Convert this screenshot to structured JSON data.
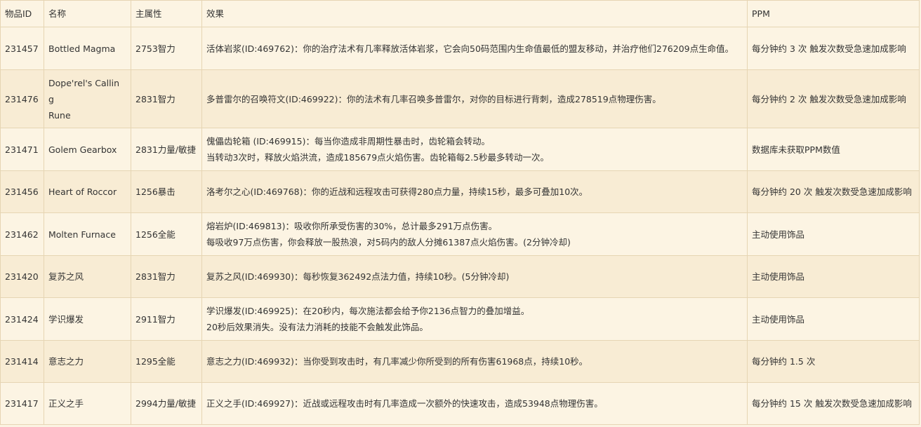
{
  "columns": {
    "id": "物品ID",
    "name": "名称",
    "stat": "主属性",
    "effect": "效果",
    "ppm": "PPM"
  },
  "rows": [
    {
      "id": "231457",
      "name": "Bottled Magma",
      "stat": "2753智力",
      "effect": [
        "活体岩浆(ID:469762)：你的治疗法术有几率释放活体岩浆，它会向50码范围内生命值最低的盟友移动，并治疗他们276209点生命值。"
      ],
      "ppm": "每分钟约 3 次 触发次数受急速加成影响"
    },
    {
      "id": "231476",
      "name": "Dope'rel's Callin g\n Rune",
      "stat": "2831智力",
      "effect": [
        "多普雷尔的召唤符文(ID:469922)：你的法术有几率召唤多普雷尔，对你的目标进行背刺，造成278519点物理伤害。"
      ],
      "ppm": "每分钟约 2 次 触发次数受急速加成影响"
    },
    {
      "id": "231471",
      "name": "Golem Gearbox",
      "stat": "2831力量/敏捷",
      "effect": [
        "傀儡齿轮箱 (ID:469915)：每当你造成非周期性暴击时，齿轮箱会转动。",
        "当转动3次时，释放火焰洪流，造成185679点火焰伤害。齿轮箱每2.5秒最多转动一次。"
      ],
      "ppm": "数据库未获取PPM数值"
    },
    {
      "id": "231456",
      "name": "Heart of Roccor",
      "stat": "1256暴击",
      "effect": [
        "洛考尔之心(ID:469768)：你的近战和远程攻击可获得280点力量，持续15秒，最多可叠加10次。"
      ],
      "ppm": "每分钟约 20 次 触发次数受急速加成影响"
    },
    {
      "id": "231462",
      "name": "Molten Furnace",
      "stat": "1256全能",
      "effect": [
        "熔岩炉(ID:469813)：吸收你所承受伤害的30%，总计最多291万点伤害。",
        "每吸收97万点伤害，你会释放一股热浪，对5码内的敌人分摊61387点火焰伤害。(2分钟冷却)"
      ],
      "ppm": "主动使用饰品"
    },
    {
      "id": "231420",
      "name": "复苏之风",
      "stat": "2831智力",
      "effect": [
        "复苏之风(ID:469930)：每秒恢复362492点法力值，持续10秒。(5分钟冷却)"
      ],
      "ppm": "主动使用饰品"
    },
    {
      "id": "231424",
      "name": "学识爆发",
      "stat": "2911智力",
      "effect": [
        "学识爆发(ID:469925)：在20秒内，每次施法都会给予你2136点智力的叠加增益。",
        "20秒后效果消失。没有法力消耗的技能不会触发此饰品。"
      ],
      "ppm": "主动使用饰品"
    },
    {
      "id": "231414",
      "name": "意志之力",
      "stat": "1295全能",
      "effect": [
        "意志之力(ID:469932)：当你受到攻击时，有几率减少你所受到的所有伤害61968点，持续10秒。"
      ],
      "ppm": "每分钟约 1.5 次"
    },
    {
      "id": "231417",
      "name": "正义之手",
      "stat": "2994力量/敏捷",
      "effect": [
        "正义之手(ID:469927)：近战或远程攻击时有几率造成一次额外的快速攻击，造成53948点物理伤害。"
      ],
      "ppm": "每分钟约 15 次 触发次数受急速加成影响"
    }
  ]
}
